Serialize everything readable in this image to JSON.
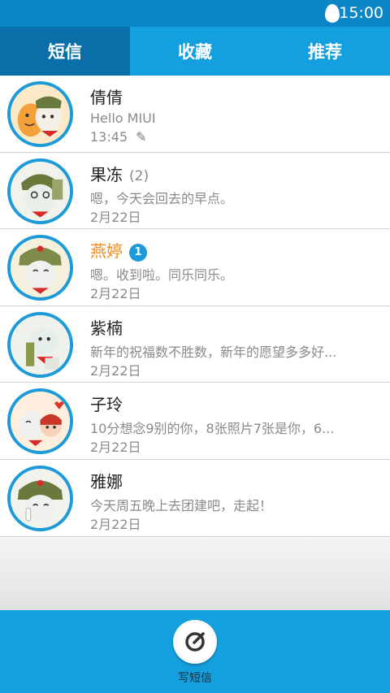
{
  "status_bar": {
    "time": "15:00"
  },
  "tabs": [
    {
      "label": "短信",
      "active": true
    },
    {
      "label": "收藏",
      "active": false
    },
    {
      "label": "推荐",
      "active": false
    }
  ],
  "conversations": [
    {
      "name": "倩倩",
      "count": "",
      "badge": "",
      "preview": "Hello MIUI",
      "date": "13:45",
      "draft": true,
      "unread": false
    },
    {
      "name": "果冻",
      "count": "(2)",
      "badge": "",
      "preview": "嗯，今天会回去的早点。",
      "date": "2月22日",
      "draft": false,
      "unread": false
    },
    {
      "name": "燕婷",
      "count": "",
      "badge": "1",
      "preview": "嗯。收到啦。同乐同乐。",
      "date": "2月22日",
      "draft": false,
      "unread": true
    },
    {
      "name": "紫楠",
      "count": "",
      "badge": "",
      "preview": "新年的祝福数不胜数，新年的愿望多多好...",
      "date": "2月22日",
      "draft": false,
      "unread": false
    },
    {
      "name": "子玲",
      "count": "",
      "badge": "",
      "preview": "10分想念9别的你，8张照片7张是你，6...",
      "date": "2月22日",
      "draft": false,
      "unread": false
    },
    {
      "name": "雅娜",
      "count": "",
      "badge": "",
      "preview": "今天周五晚上去团建吧，走起！",
      "date": "2月22日",
      "draft": false,
      "unread": false
    }
  ],
  "compose": {
    "label": "写短信",
    "icon": "compose-icon"
  },
  "colors": {
    "accent": "#14a0de",
    "active_tab": "#0a6fa8",
    "unread_name": "#f08a1c",
    "badge": "#1d9ad8"
  }
}
